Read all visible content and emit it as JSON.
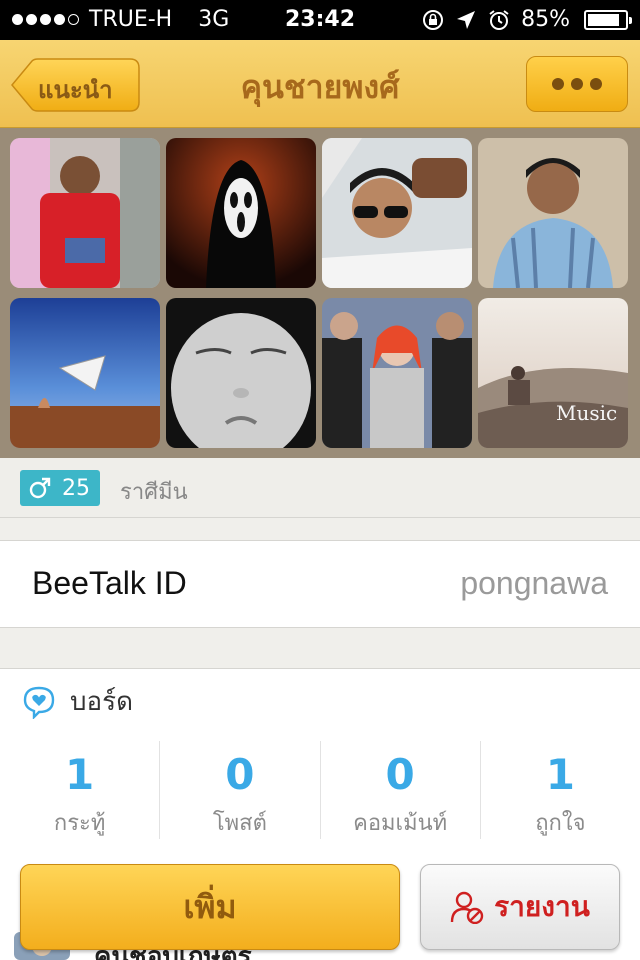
{
  "status_bar": {
    "carrier": "TRUE-H",
    "network": "3G",
    "time": "23:42",
    "battery": "85%",
    "battery_level": 0.85,
    "icons": [
      "rotation-lock-icon",
      "location-arrow-icon",
      "alarm-icon"
    ]
  },
  "nav": {
    "back_label": "แนะนำ",
    "title": "คุนชายพงศ์",
    "more_icon": "more-dots-icon"
  },
  "photos": [
    {
      "subject": "man in red shirt"
    },
    {
      "subject": "ghost mask"
    },
    {
      "subject": "man with sunglasses selfie"
    },
    {
      "subject": "man in striped shirt"
    },
    {
      "subject": "blue sky desert scene"
    },
    {
      "subject": "crying child"
    },
    {
      "subject": "band photo"
    },
    {
      "subject": "person sitting on hill",
      "caption": "Music"
    }
  ],
  "profile": {
    "gender_icon": "male-icon",
    "age": "25",
    "zodiac": "ราศีมีน"
  },
  "beetalk": {
    "label": "BeeTalk ID",
    "value": "pongnawa"
  },
  "board": {
    "icon": "heart-chat-icon",
    "title": "บอร์ด",
    "stats": [
      {
        "value": "1",
        "label": "กระทู้"
      },
      {
        "value": "0",
        "label": "โพสต์"
      },
      {
        "value": "0",
        "label": "คอมเม้นท์"
      },
      {
        "value": "1",
        "label": "ถูกใจ"
      }
    ],
    "peek_text": "คุนชอบเกษตร"
  },
  "actions": {
    "add_label": "เพิ่ม",
    "report_label": "รายงาน",
    "report_icon": "report-user-icon"
  },
  "colors": {
    "nav_gold": "#efc050",
    "accent_blue": "#3aa9e6",
    "badge_teal": "#3db6c8",
    "report_red": "#cf2020"
  }
}
